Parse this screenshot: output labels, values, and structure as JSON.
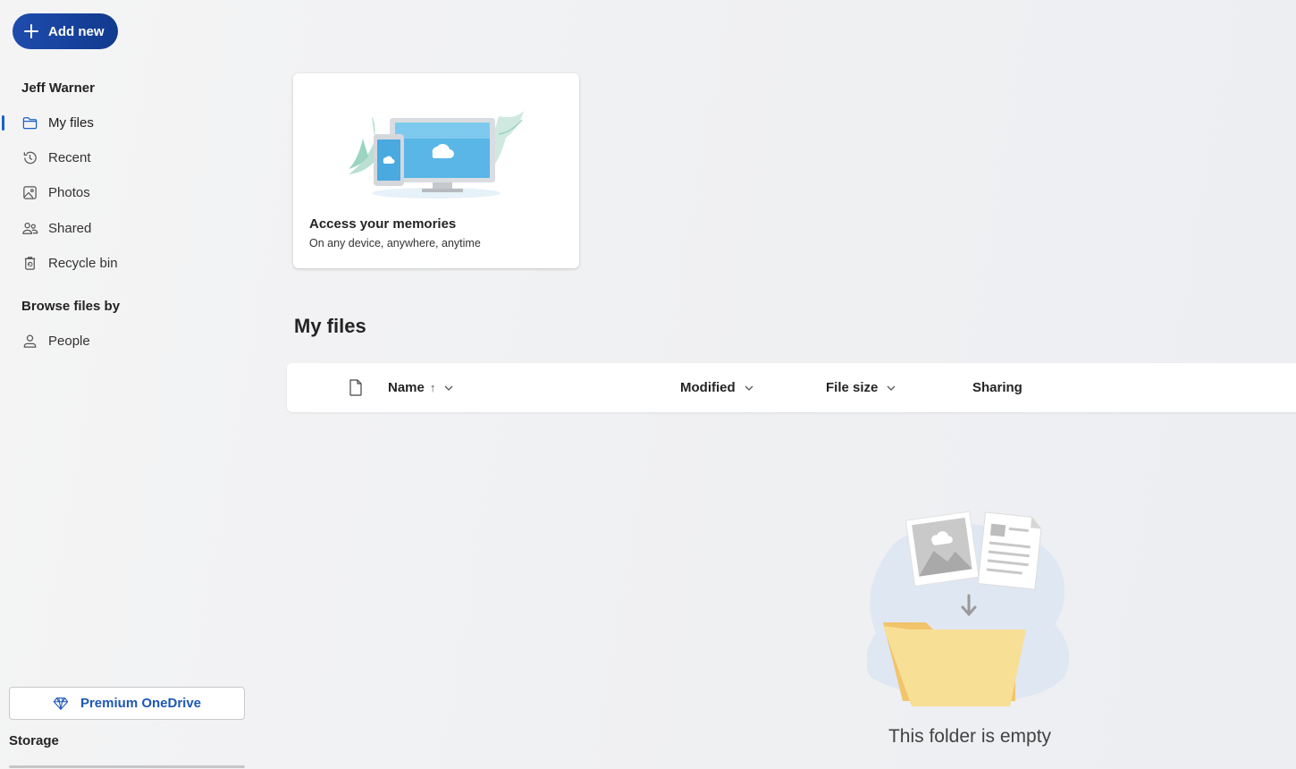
{
  "toolbar": {
    "add_new_label": "Add new"
  },
  "sidebar": {
    "user_name": "Jeff Warner",
    "items": [
      {
        "label": "My files",
        "icon": "folder-icon",
        "active": true
      },
      {
        "label": "Recent",
        "icon": "history-icon",
        "active": false
      },
      {
        "label": "Photos",
        "icon": "image-icon",
        "active": false
      },
      {
        "label": "Shared",
        "icon": "people-icon",
        "active": false
      },
      {
        "label": "Recycle bin",
        "icon": "recycle-bin-icon",
        "active": false
      }
    ],
    "browse_title": "Browse files by",
    "browse_items": [
      {
        "label": "People",
        "icon": "person-icon"
      }
    ],
    "premium_label": "Premium OneDrive",
    "storage_label": "Storage"
  },
  "promo_card": {
    "title": "Access your memories",
    "subtitle": "On any device, anywhere, anytime"
  },
  "main": {
    "heading": "My files",
    "columns": {
      "name": "Name",
      "name_sort": "↑",
      "modified": "Modified",
      "file_size": "File size",
      "sharing": "Sharing"
    },
    "empty_message": "This folder is empty"
  },
  "colors": {
    "accent": "#1a60c7",
    "add_button": "#1f4cad",
    "background": "#f1f1f3"
  }
}
